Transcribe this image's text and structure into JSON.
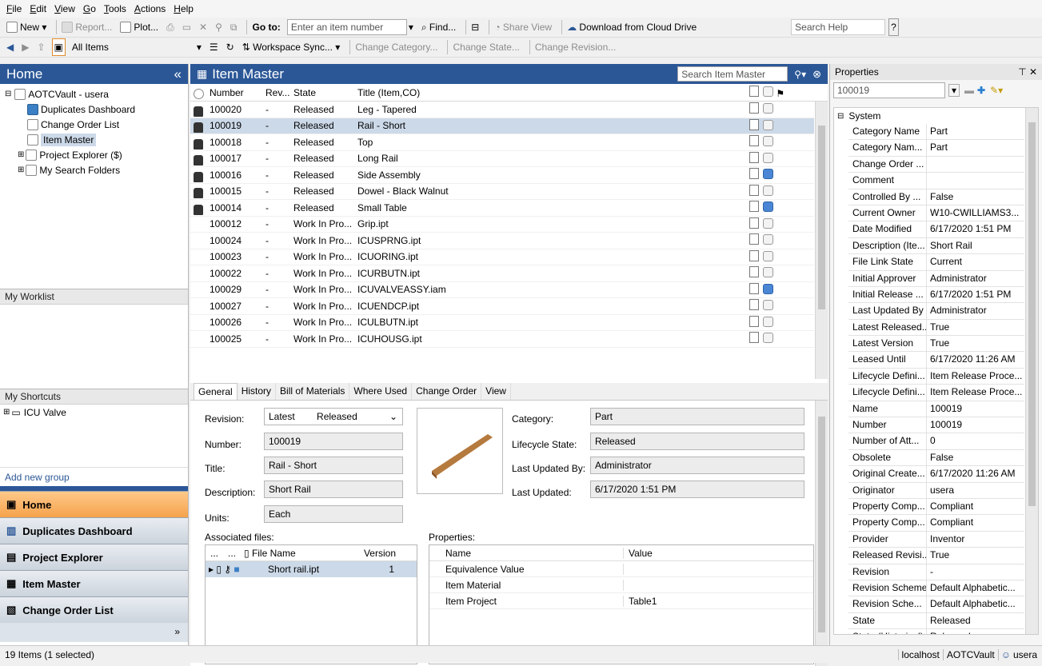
{
  "menu": [
    "File",
    "Edit",
    "View",
    "Go",
    "Tools",
    "Actions",
    "Help"
  ],
  "toolbar1": {
    "new": "New",
    "report": "Report...",
    "plot": "Plot...",
    "goto_label": "Go to:",
    "goto_placeholder": "Enter an item number",
    "find": "Find...",
    "share_view": "Share View",
    "download": "Download from Cloud Drive",
    "search_help": "Search Help"
  },
  "toolbar2": {
    "all_items": "All Items",
    "workspace_sync": "Workspace Sync...",
    "change_category": "Change Category...",
    "change_state": "Change State...",
    "change_revision": "Change Revision..."
  },
  "left": {
    "title": "Home",
    "tree_root": "AOTCVault - usera",
    "tree_items": [
      "Duplicates Dashboard",
      "Change Order List",
      "Item Master",
      "Project Explorer ($)",
      "My Search Folders"
    ],
    "worklist": "My Worklist",
    "shortcuts": "My Shortcuts",
    "shortcut_items": [
      "ICU Valve"
    ],
    "add_group": "Add new group",
    "nav": [
      "Home",
      "Duplicates Dashboard",
      "Project Explorer",
      "Item Master",
      "Change Order List"
    ]
  },
  "item_master": {
    "title": "Item Master",
    "search_placeholder": "Search Item Master",
    "columns": [
      "Number",
      "Rev...",
      "State",
      "Title (Item,CO)"
    ],
    "rows": [
      {
        "number": "100020",
        "rev": "-",
        "state": "Released",
        "title": "Leg - Tapered",
        "locked": true,
        "blue": false
      },
      {
        "number": "100019",
        "rev": "-",
        "state": "Released",
        "title": "Rail - Short",
        "locked": true,
        "blue": false,
        "selected": true
      },
      {
        "number": "100018",
        "rev": "-",
        "state": "Released",
        "title": "Top",
        "locked": true,
        "blue": false
      },
      {
        "number": "100017",
        "rev": "-",
        "state": "Released",
        "title": "Long Rail",
        "locked": true,
        "blue": false
      },
      {
        "number": "100016",
        "rev": "-",
        "state": "Released",
        "title": "Side Assembly",
        "locked": true,
        "blue": true
      },
      {
        "number": "100015",
        "rev": "-",
        "state": "Released",
        "title": "Dowel - Black Walnut",
        "locked": true,
        "blue": false
      },
      {
        "number": "100014",
        "rev": "-",
        "state": "Released",
        "title": "Small Table",
        "locked": true,
        "blue": true
      },
      {
        "number": "100012",
        "rev": "-",
        "state": "Work In Pro...",
        "title": "Grip.ipt",
        "locked": false,
        "blue": false
      },
      {
        "number": "100024",
        "rev": "-",
        "state": "Work In Pro...",
        "title": "ICUSPRNG.ipt",
        "locked": false,
        "blue": false
      },
      {
        "number": "100023",
        "rev": "-",
        "state": "Work In Pro...",
        "title": "ICUORING.ipt",
        "locked": false,
        "blue": false
      },
      {
        "number": "100022",
        "rev": "-",
        "state": "Work In Pro...",
        "title": "ICURBUTN.ipt",
        "locked": false,
        "blue": false
      },
      {
        "number": "100029",
        "rev": "-",
        "state": "Work In Pro...",
        "title": "ICUVALVEASSY.iam",
        "locked": false,
        "blue": true
      },
      {
        "number": "100027",
        "rev": "-",
        "state": "Work In Pro...",
        "title": "ICUENDCP.ipt",
        "locked": false,
        "blue": false
      },
      {
        "number": "100026",
        "rev": "-",
        "state": "Work In Pro...",
        "title": "ICULBUTN.ipt",
        "locked": false,
        "blue": false
      },
      {
        "number": "100025",
        "rev": "-",
        "state": "Work In Pro...",
        "title": "ICUHOUSG.ipt",
        "locked": false,
        "blue": false
      }
    ]
  },
  "detail": {
    "tabs": [
      "General",
      "History",
      "Bill of Materials",
      "Where Used",
      "Change Order",
      "View"
    ],
    "revision_label": "Revision:",
    "revision_value": "Latest",
    "revision_state": "Released",
    "number_label": "Number:",
    "number_value": "100019",
    "title_label": "Title:",
    "title_value": "Rail - Short",
    "description_label": "Description:",
    "description_value": "Short Rail",
    "units_label": "Units:",
    "units_value": "Each",
    "category_label": "Category:",
    "category_value": "Part",
    "lifecycle_label": "Lifecycle State:",
    "lifecycle_value": "Released",
    "updated_by_label": "Last Updated By:",
    "updated_by_value": "Administrator",
    "updated_label": "Last Updated:",
    "updated_value": "6/17/2020 1:51 PM",
    "assoc_label": "Associated files:",
    "assoc_cols": [
      "...",
      "...",
      "File Name",
      "Version"
    ],
    "assoc_file": "Short rail.ipt",
    "assoc_version": "1",
    "props_label": "Properties:",
    "props_cols": [
      "Name",
      "Value"
    ],
    "props_rows": [
      {
        "name": "Equivalence Value",
        "value": ""
      },
      {
        "name": "Item Material",
        "value": ""
      },
      {
        "name": "Item Project",
        "value": "Table1"
      }
    ]
  },
  "properties": {
    "title": "Properties",
    "selected": "100019",
    "group": "System",
    "rows": [
      [
        "Category Name",
        "Part"
      ],
      [
        "Category Nam...",
        "Part"
      ],
      [
        "Change Order ...",
        ""
      ],
      [
        "Comment",
        ""
      ],
      [
        "Controlled By ...",
        "False"
      ],
      [
        "Current Owner",
        "W10-CWILLIAMS3..."
      ],
      [
        "Date Modified",
        "6/17/2020 1:51 PM"
      ],
      [
        "Description (Ite...",
        "Short Rail"
      ],
      [
        "File Link State",
        "Current"
      ],
      [
        "Initial Approver",
        "Administrator"
      ],
      [
        "Initial Release ...",
        "6/17/2020 1:51 PM"
      ],
      [
        "Last Updated By",
        "Administrator"
      ],
      [
        "Latest Released...",
        "True"
      ],
      [
        "Latest Version",
        "True"
      ],
      [
        "Leased Until",
        "6/17/2020 11:26 AM"
      ],
      [
        "Lifecycle Defini...",
        "Item Release Proce..."
      ],
      [
        "Lifecycle Defini...",
        "Item Release Proce..."
      ],
      [
        "Name",
        "100019"
      ],
      [
        "Number",
        "100019"
      ],
      [
        "Number of Att...",
        "0"
      ],
      [
        "Obsolete",
        "False"
      ],
      [
        "Original Create...",
        "6/17/2020 11:26 AM"
      ],
      [
        "Originator",
        "usera"
      ],
      [
        "Property Comp...",
        "Compliant"
      ],
      [
        "Property Comp...",
        "Compliant"
      ],
      [
        "Provider",
        "Inventor"
      ],
      [
        "Released Revisi...",
        "True"
      ],
      [
        "Revision",
        "-"
      ],
      [
        "Revision Scheme",
        "Default Alphabetic..."
      ],
      [
        "Revision Sche...",
        "Default Alphabetic..."
      ],
      [
        "State",
        "Released"
      ],
      [
        "State (Historical)",
        "Released"
      ]
    ]
  },
  "status": {
    "left": "19 Items (1 selected)",
    "server": "localhost",
    "vault": "AOTCVault",
    "user": "usera"
  }
}
